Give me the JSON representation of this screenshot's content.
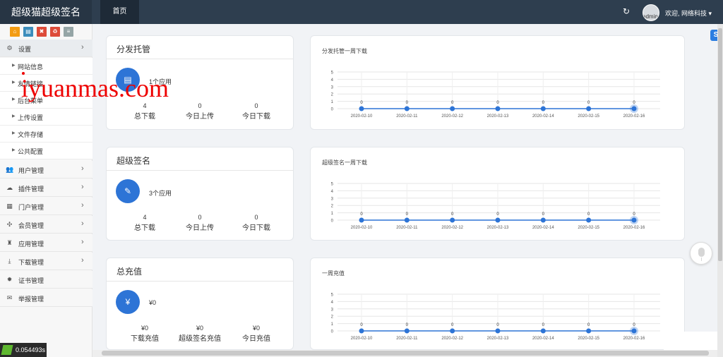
{
  "header": {
    "brand": "超级猫超级签名",
    "nav_home": "首页",
    "refresh_icon": "refresh-icon",
    "avatar_text": "admin",
    "welcome": "欢迎, 网络科技 ▾"
  },
  "sidebar": {
    "quick_buttons": [
      {
        "icon": "home-icon",
        "color": "#f39c12",
        "glyph": "⌂"
      },
      {
        "icon": "file-icon",
        "color": "#3c8dbc",
        "glyph": "▤"
      },
      {
        "icon": "trash-icon",
        "color": "#dd4b39",
        "glyph": "✖"
      },
      {
        "icon": "recycle-icon",
        "color": "#dd4b39",
        "glyph": "♻"
      },
      {
        "icon": "list-icon",
        "color": "#95a5a6",
        "glyph": "≡"
      }
    ],
    "settings": {
      "label": "设置",
      "icon": "gears-icon"
    },
    "subitems": [
      "网站信息",
      "友情链接",
      "后台菜单",
      "上传设置",
      "文件存储",
      "公共配置"
    ],
    "menus": [
      {
        "label": "用户管理",
        "icon": "users-icon",
        "glyph": "👥"
      },
      {
        "label": "插件管理",
        "icon": "cloud-icon",
        "glyph": "☁"
      },
      {
        "label": "门户管理",
        "icon": "grid-icon",
        "glyph": "▦"
      },
      {
        "label": "会员管理",
        "icon": "arrows-icon",
        "glyph": "✣"
      },
      {
        "label": "应用管理",
        "icon": "android-icon",
        "glyph": "♜"
      },
      {
        "label": "下载管理",
        "icon": "download-icon",
        "glyph": "⤓"
      },
      {
        "label": "证书管理",
        "icon": "badge-icon",
        "glyph": "✹"
      },
      {
        "label": "举报管理",
        "icon": "envelope-icon",
        "glyph": "✉"
      }
    ],
    "timer": "0.054493s"
  },
  "watermark": "iyuanmas.com",
  "stats": [
    {
      "title": "分发托管",
      "icon": "file-icon",
      "glyph": "▤",
      "desc": "1个应用",
      "cols": [
        {
          "num": "4",
          "label": "总下载"
        },
        {
          "num": "0",
          "label": "今日上传"
        },
        {
          "num": "0",
          "label": "今日下载"
        }
      ]
    },
    {
      "title": "超级签名",
      "icon": "pencil-icon",
      "glyph": "✎",
      "desc": "3个应用",
      "cols": [
        {
          "num": "4",
          "label": "总下载"
        },
        {
          "num": "0",
          "label": "今日上传"
        },
        {
          "num": "0",
          "label": "今日下载"
        }
      ]
    },
    {
      "title": "总充值",
      "icon": "yen-icon",
      "glyph": "¥",
      "desc": "¥0",
      "cols": [
        {
          "num": "¥0",
          "label": "下载充值"
        },
        {
          "num": "¥0",
          "label": "超级签名充值"
        },
        {
          "num": "¥0",
          "label": "今日充值"
        }
      ]
    }
  ],
  "chart_data": [
    {
      "type": "line",
      "title": "分发托管一周下载",
      "x": [
        "2020-02-10",
        "2020-02-11",
        "2020-02-12",
        "2020-02-13",
        "2020-02-14",
        "2020-02-15",
        "2020-02-16"
      ],
      "series": [
        {
          "values": [
            0,
            0,
            0,
            0,
            0,
            0,
            0
          ]
        }
      ],
      "ylim": [
        0,
        5
      ],
      "yticks": [
        0,
        1,
        2,
        3,
        4,
        5
      ],
      "grid": true,
      "color": "#2d74d6"
    },
    {
      "type": "line",
      "title": "超级签名一周下载",
      "x": [
        "2020-02-10",
        "2020-02-11",
        "2020-02-12",
        "2020-02-13",
        "2020-02-14",
        "2020-02-15",
        "2020-02-16"
      ],
      "series": [
        {
          "values": [
            0,
            0,
            0,
            0,
            0,
            0,
            0
          ]
        }
      ],
      "ylim": [
        0,
        5
      ],
      "yticks": [
        0,
        1,
        2,
        3,
        4,
        5
      ],
      "grid": true,
      "color": "#2d74d6"
    },
    {
      "type": "line",
      "title": "一周充值",
      "x": [
        "2020-02-10",
        "2020-02-11",
        "2020-02-12",
        "2020-02-13",
        "2020-02-14",
        "2020-02-15",
        "2020-02-16"
      ],
      "series": [
        {
          "values": [
            0,
            0,
            0,
            0,
            0,
            0,
            0
          ]
        }
      ],
      "ylim": [
        0,
        5
      ],
      "yticks": [
        0,
        1,
        2,
        3,
        4,
        5
      ],
      "grid": true,
      "color": "#2d74d6"
    }
  ]
}
